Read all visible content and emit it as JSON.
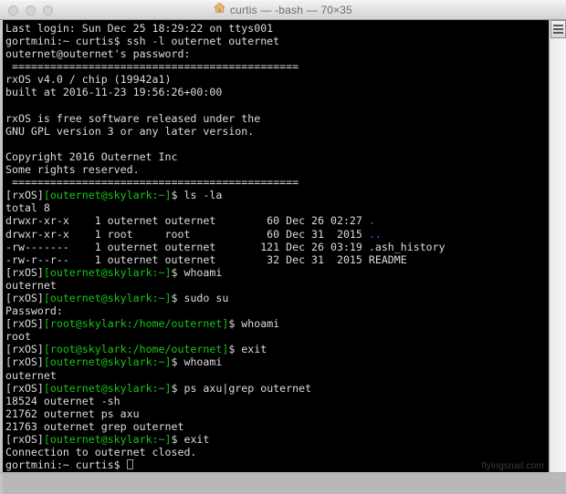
{
  "window": {
    "title": "curtis — -bash — 70×35",
    "icon": "home-icon",
    "traffic_lights": [
      "close-button",
      "minimize-button",
      "zoom-button"
    ],
    "cols": "70",
    "rows": "35"
  },
  "theme": {
    "background": "#000000",
    "foreground": "#dcdcdc",
    "prompt_green": "#19c419",
    "dir_blue": "#5c5cff",
    "titlebar_text": "#6d6d6d"
  },
  "watermark": "flyingsnail.com",
  "terminal": {
    "lines": [
      [
        {
          "t": "Last login: Sun Dec 25 18:29:22 on ttys001",
          "c": "white"
        }
      ],
      [
        {
          "t": "gortmini:~ curtis$ ssh -l outernet outernet",
          "c": "white"
        }
      ],
      [
        {
          "t": "outernet@outernet's password:",
          "c": "white"
        }
      ],
      [
        {
          "t": " =============================================",
          "c": "white"
        }
      ],
      [
        {
          "t": "rxOS v4.0 / chip (19942a1)",
          "c": "white"
        }
      ],
      [
        {
          "t": "built at 2016-11-23 19:56:26+00:00",
          "c": "white"
        }
      ],
      [
        {
          "t": "",
          "c": "white"
        }
      ],
      [
        {
          "t": "rxOS is free software released under the",
          "c": "white"
        }
      ],
      [
        {
          "t": "GNU GPL version 3 or any later version.",
          "c": "white"
        }
      ],
      [
        {
          "t": "",
          "c": "white"
        }
      ],
      [
        {
          "t": "Copyright 2016 Outernet Inc",
          "c": "white"
        }
      ],
      [
        {
          "t": "Some rights reserved.",
          "c": "white"
        }
      ],
      [
        {
          "t": " =============================================",
          "c": "white"
        }
      ],
      [
        {
          "t": "[rxOS]",
          "c": "white"
        },
        {
          "t": "[outernet@skylark:~]",
          "c": "green"
        },
        {
          "t": "$ ls -la",
          "c": "white"
        }
      ],
      [
        {
          "t": "total 8",
          "c": "white"
        }
      ],
      [
        {
          "t": "drwxr-xr-x    1 outernet outernet        60 Dec 26 02:27 ",
          "c": "white"
        },
        {
          "t": ".",
          "c": "blue"
        }
      ],
      [
        {
          "t": "drwxr-xr-x    1 root     root            60 Dec 31  2015 ",
          "c": "white"
        },
        {
          "t": "..",
          "c": "blue"
        }
      ],
      [
        {
          "t": "-rw-------    1 outernet outernet       121 Dec 26 03:19 .ash_history",
          "c": "white"
        }
      ],
      [
        {
          "t": "-rw-r--r--    1 outernet outernet        32 Dec 31  2015 README",
          "c": "white"
        }
      ],
      [
        {
          "t": "[rxOS]",
          "c": "white"
        },
        {
          "t": "[outernet@skylark:~]",
          "c": "green"
        },
        {
          "t": "$ whoami",
          "c": "white"
        }
      ],
      [
        {
          "t": "outernet",
          "c": "white"
        }
      ],
      [
        {
          "t": "[rxOS]",
          "c": "white"
        },
        {
          "t": "[outernet@skylark:~]",
          "c": "green"
        },
        {
          "t": "$ sudo su",
          "c": "white"
        }
      ],
      [
        {
          "t": "Password:",
          "c": "white"
        }
      ],
      [
        {
          "t": "[rxOS]",
          "c": "white"
        },
        {
          "t": "[root@skylark:/home/outernet]",
          "c": "green"
        },
        {
          "t": "$ whoami",
          "c": "white"
        }
      ],
      [
        {
          "t": "root",
          "c": "white"
        }
      ],
      [
        {
          "t": "[rxOS]",
          "c": "white"
        },
        {
          "t": "[root@skylark:/home/outernet]",
          "c": "green"
        },
        {
          "t": "$ exit",
          "c": "white"
        }
      ],
      [
        {
          "t": "[rxOS]",
          "c": "white"
        },
        {
          "t": "[outernet@skylark:~]",
          "c": "green"
        },
        {
          "t": "$ whoami",
          "c": "white"
        }
      ],
      [
        {
          "t": "outernet",
          "c": "white"
        }
      ],
      [
        {
          "t": "[rxOS]",
          "c": "white"
        },
        {
          "t": "[outernet@skylark:~]",
          "c": "green"
        },
        {
          "t": "$ ps axu|grep outernet",
          "c": "white"
        }
      ],
      [
        {
          "t": "18524 outernet -sh",
          "c": "white"
        }
      ],
      [
        {
          "t": "21762 outernet ps axu",
          "c": "white"
        }
      ],
      [
        {
          "t": "21763 outernet grep outernet",
          "c": "white"
        }
      ],
      [
        {
          "t": "[rxOS]",
          "c": "white"
        },
        {
          "t": "[outernet@skylark:~]",
          "c": "green"
        },
        {
          "t": "$ exit",
          "c": "white"
        }
      ],
      [
        {
          "t": "Connection to outernet closed.",
          "c": "white"
        }
      ],
      [
        {
          "t": "gortmini:~ curtis$ ",
          "c": "white"
        },
        {
          "t": "CURSOR",
          "c": "cursor"
        }
      ]
    ]
  }
}
